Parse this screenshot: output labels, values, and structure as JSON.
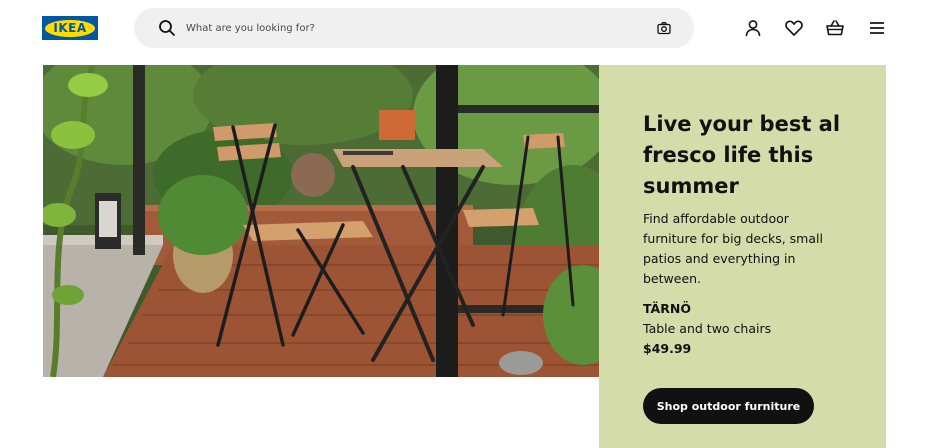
{
  "header": {
    "logo_text": "IKEA",
    "search": {
      "placeholder": "What are you looking for?",
      "value": ""
    },
    "icons": [
      "search-icon",
      "camera-icon",
      "profile-icon",
      "heart-icon",
      "basket-icon",
      "menu-icon"
    ]
  },
  "hero": {
    "image_alt": "Outdoor patio with wooden table and two folding chairs surrounded by plants"
  },
  "promo": {
    "title": "Live your best al fresco life this summer",
    "description": "Find affordable outdoor furniture for big decks, small patios and everything in between.",
    "product_name": "TÄRNÖ",
    "product_desc": "Table and two chairs",
    "product_price": "$49.99",
    "button_label": "Shop outdoor furniture"
  },
  "colors": {
    "brand_blue": "#0058a3",
    "brand_yellow": "#ffdb00",
    "panel_bg": "#d4dcaa",
    "button_bg": "#111111",
    "search_bg": "#f0f0f0"
  }
}
